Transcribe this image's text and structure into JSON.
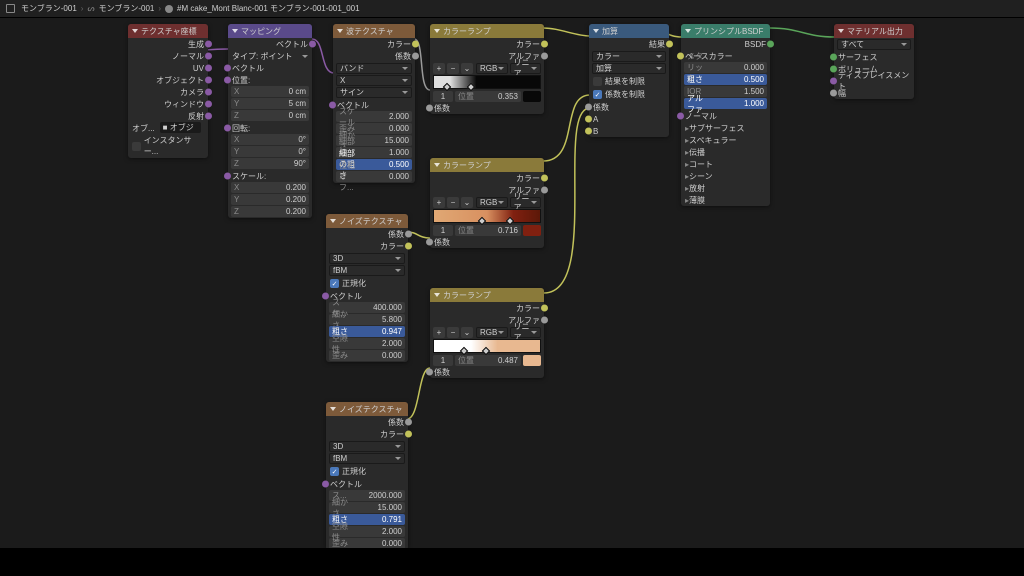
{
  "breadcrumb": [
    "モンブラン-001",
    "モンブラン-001",
    "#M cake_Mont Blanc-001 モンブラン-001-001_001"
  ],
  "nodes": {
    "texcoord": {
      "title": "テクスチャ座標",
      "outs": [
        "生成",
        "ノーマル",
        "UV",
        "オブジェクト",
        "カメラ",
        "ウィンドウ",
        "反射"
      ],
      "obj_label": "オブ...",
      "obj_field": "■ オブジ",
      "instancer": "インスタンサー..."
    },
    "mapping": {
      "title": "マッピング",
      "out": "ベクトル",
      "type_l": "タイプ:",
      "type_v": "ポイント",
      "vec": "ベクトル",
      "loc": "位置:",
      "rot": "回転:",
      "scale": "スケール:",
      "loc_vals": [
        [
          "X",
          "0 cm"
        ],
        [
          "Y",
          "5 cm"
        ],
        [
          "Z",
          "0 cm"
        ]
      ],
      "rot_vals": [
        [
          "X",
          "0°"
        ],
        [
          "Y",
          "0°"
        ],
        [
          "Z",
          "90°"
        ]
      ],
      "scale_vals": [
        [
          "X",
          "0.200"
        ],
        [
          "Y",
          "0.200"
        ],
        [
          "Z",
          "0.200"
        ]
      ]
    },
    "wave": {
      "title": "波テクスチャ",
      "out_color": "カラー",
      "out_fac": "係数",
      "dd1": "バンド",
      "dd2": "X",
      "dd3": "サイン",
      "vec": "ベクトル",
      "params": [
        [
          "スケール",
          "2.000"
        ],
        [
          "歪み",
          "0.000"
        ],
        [
          "細かさ",
          "15.000"
        ],
        [
          "細部のス...",
          "1.000"
        ],
        [
          "細部の粗さ",
          "0.500"
        ],
        [
          "位相オフ...",
          "0.000"
        ]
      ],
      "blue_idx": 4
    },
    "noise": {
      "title": "ノイズテクスチャ",
      "out_fac": "係数",
      "out_color": "カラー",
      "dd1": "3D",
      "dd2": "fBM",
      "normalize": "正規化",
      "vec": "ベクトル",
      "params1": [
        [
          "スケ...",
          "400.000"
        ],
        [
          "細かさ",
          "5.800"
        ],
        [
          "粗さ",
          "0.947"
        ],
        [
          "空隙性",
          "2.000"
        ],
        [
          "歪み",
          "0.000"
        ]
      ],
      "blue1": 2,
      "params2": [
        [
          "ス...",
          "2000.000"
        ],
        [
          "細かさ",
          "15.000"
        ],
        [
          "粗さ",
          "0.791"
        ],
        [
          "空隙性",
          "2.000"
        ],
        [
          "歪み",
          "0.000"
        ]
      ],
      "blue2": 2
    },
    "ramp": {
      "title": "カラーランプ",
      "out_color": "カラー",
      "out_alpha": "アルファ",
      "mode1": "RGB",
      "mode2": "リニア",
      "idx": "1",
      "pos_l": "位置",
      "pos1": "0.353",
      "pos2": "0.716",
      "pos3": "0.487",
      "in": "係数",
      "grad1": [
        "#e0e0e0",
        "#080808"
      ],
      "grad2": [
        "#d89060",
        "#802010"
      ],
      "grad3": [
        "#ffffff",
        "#e8b890"
      ]
    },
    "math": {
      "title": "加算",
      "out": "結果",
      "dd": "加算",
      "result_clamp": "結果を制限",
      "fac_clamp": "係数を制限",
      "in_col": "カラー",
      "in_fac": "係数",
      "in_a": "A",
      "in_b": "B"
    },
    "bsdf": {
      "title": "プリンシプルBSDF",
      "out": "BSDF",
      "base": "ベースカラー",
      "params": [
        [
          "メタリック",
          "0.000"
        ],
        [
          "粗さ",
          "0.500"
        ],
        [
          "IOR",
          "1.500"
        ],
        [
          "アルファ",
          "1.000"
        ]
      ],
      "blue_idx": [
        1,
        3
      ],
      "subs": [
        "ノーマル",
        "サブサーフェス",
        "スペキュラー",
        "伝播",
        "コート",
        "シーン",
        "放射",
        "薄膜"
      ]
    },
    "output": {
      "title": "マテリアル出力",
      "dd": "すべて",
      "ins": [
        "サーフェス",
        "ボリューム",
        "ディスプレイスメント",
        "幅"
      ]
    }
  }
}
